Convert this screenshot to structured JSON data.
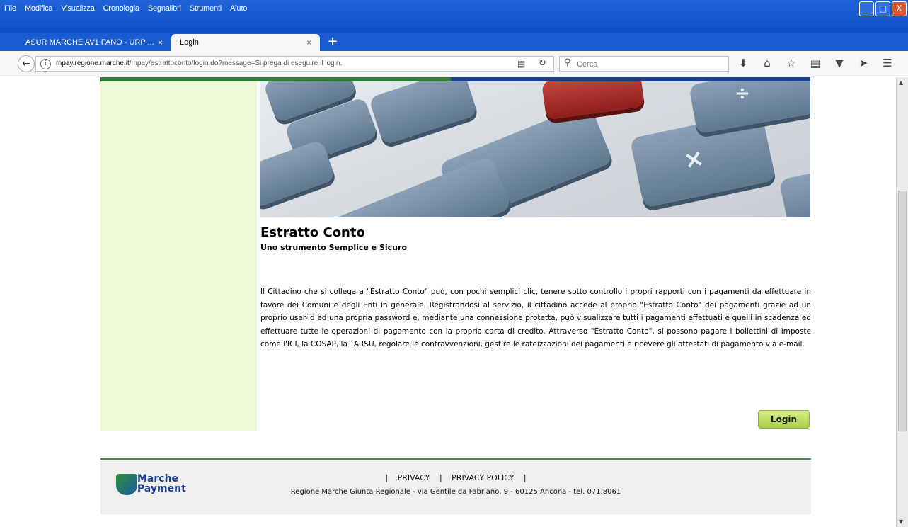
{
  "browser": {
    "menu": [
      "File",
      "Modifica",
      "Visualizza",
      "Cronologia",
      "Segnalibri",
      "Strumenti",
      "Aiuto"
    ],
    "tabs": [
      {
        "title": "ASUR MARCHE AV1 FANO - URP ...",
        "close": "×"
      },
      {
        "title": "Login",
        "close": "×"
      }
    ],
    "new_tab": "+",
    "url_domain": "mpay.regione.marche.it",
    "url_path": "/mpay/estrattoconto/login.do?message=Si prega di eseguire il login.",
    "search_placeholder": "Cerca",
    "window_buttons": {
      "minimize": "_",
      "maximize": "□",
      "close": "X"
    }
  },
  "page": {
    "title": "Estratto Conto",
    "subtitle": "Uno strumento Semplice e Sicuro",
    "description": "Il Cittadino che si collega a \"Estratto Conto\" può, con pochi semplici clic, tenere sotto controllo i propri rapporti con i pagamenti da effettuare in favore dei Comuni e degli Enti in generale. Registrandosi al servizio, il cittadino accede al proprio \"Estratto Conto\" dei pagamenti grazie ad un proprio user-id ed una propria password e, mediante una connessione protetta, può visualizzare tutti i pagamenti effettuati e quelli in scadenza ed effettuare tutte le operazioni di pagamento con la propria carta di credito. Attraverso \"Estratto Conto\", si possono pagare i bollettini di imposte come l'ICI, la COSAP, la TARSU, regolare le contravvenzioni, gestire le rateizzazioni dei pagamenti e ricevere gli attestati di pagamento via e-mail.",
    "login_button": "Login",
    "colors": {
      "sidebar": "#eef7d8",
      "topbar_green": "#2e7d3b",
      "topbar_blue": "#1b3f8f",
      "login_button": "#b9dc5a"
    }
  },
  "footer": {
    "logo_line1": "Marche",
    "logo_line2": "Payment",
    "separator": "|",
    "privacy": "PRIVACY",
    "privacy_policy": "PRIVACY POLICY",
    "address": "Regione Marche Giunta Regionale - via Gentile da Fabriano, 9 - 60125 Ancona - tel. 071.8061"
  },
  "icons": {
    "back": "back-arrow-icon",
    "info": "info-icon",
    "reader": "reader-view-icon",
    "reload": "reload-icon",
    "search": "search-icon",
    "toolbar": [
      "download-icon",
      "home-icon",
      "bookmark-star-icon",
      "bookmarks-menu-icon",
      "pocket-icon",
      "send-tab-icon",
      "hamburger-menu-icon"
    ]
  }
}
